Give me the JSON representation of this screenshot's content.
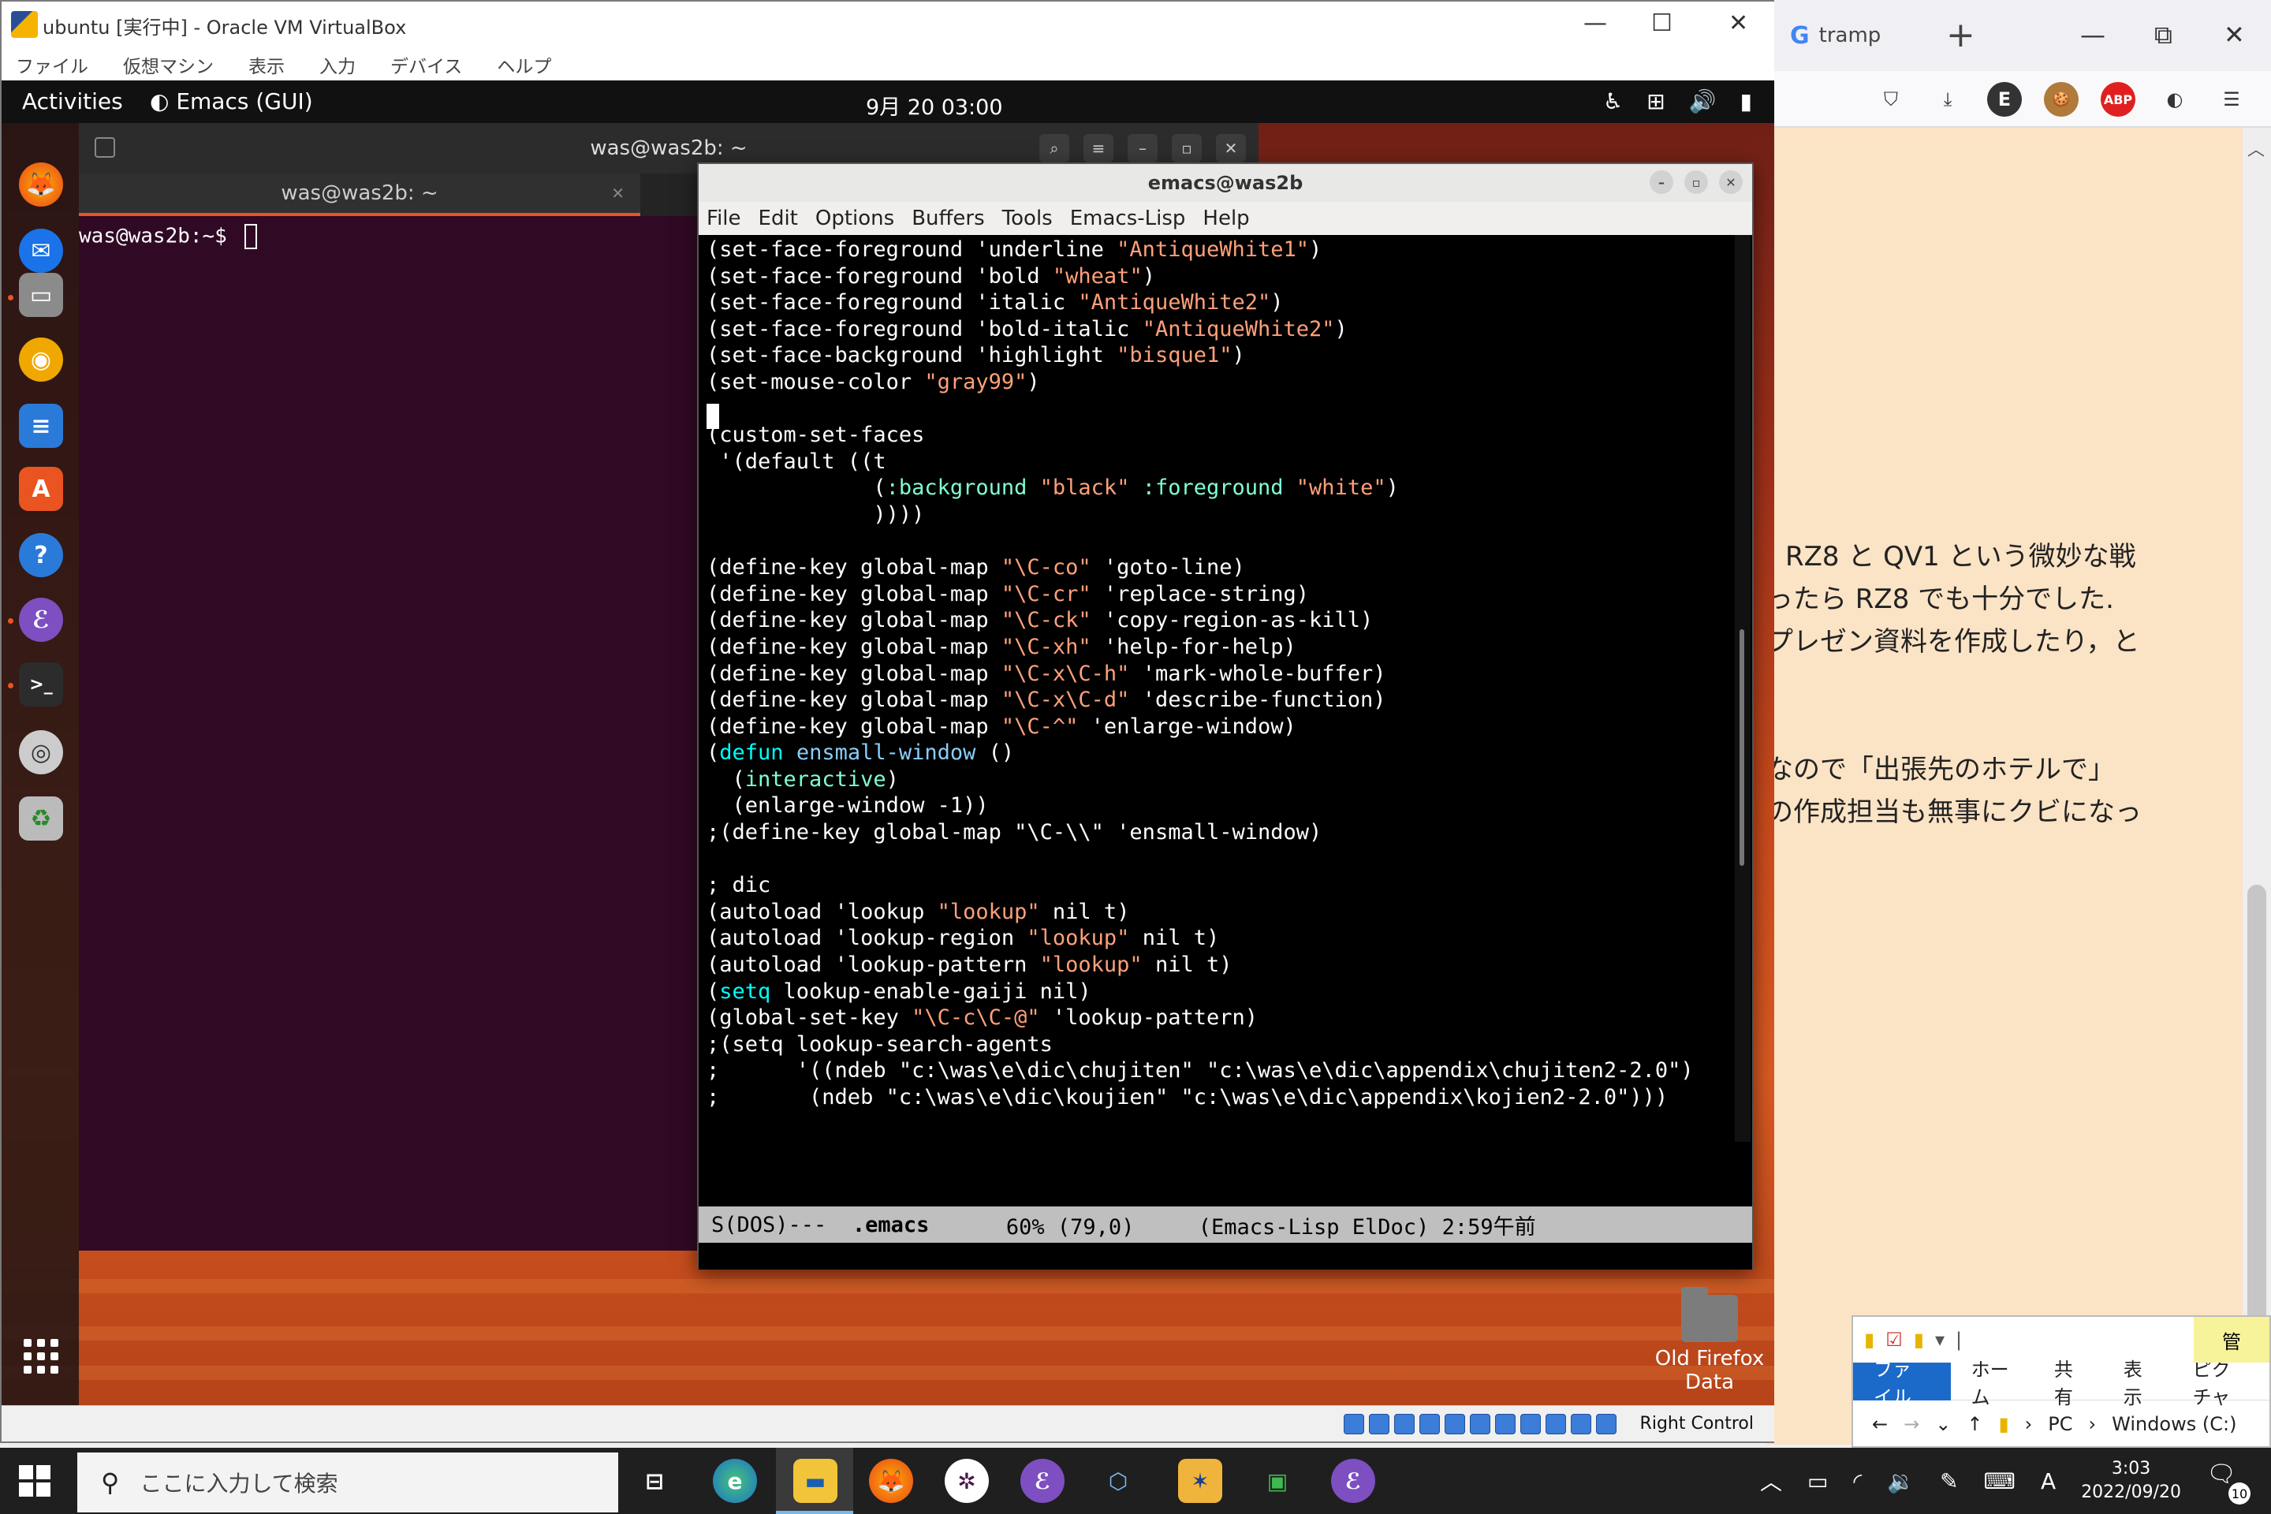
{
  "firefox": {
    "tab_title": "tramp",
    "tab_favicon": "G",
    "new_tab": "+",
    "win_min": "—",
    "win_restore": "⧉",
    "win_close": "✕",
    "toolbar_icons": [
      "pocket-icon",
      "download-icon",
      "extension-e-icon",
      "cookie-icon",
      "adblock-icon",
      "firefox-account-icon",
      "menu-icon"
    ],
    "toolbar_labels": [
      "⛉",
      "⤓",
      "E",
      "🍪",
      "ABP",
      "◐",
      "☰"
    ],
    "content_lines": [
      "RZ8 と QV1 という微妙な戦",
      "ったら RZ8 でも十分でした.",
      "プレゼン資料を作成したり，と",
      "なので「出張先のホテルで」",
      "の作成担当も無事にクビになっ"
    ]
  },
  "explorer": {
    "kanri": "管",
    "ribbon": [
      "ファイル",
      "ホーム",
      "共有",
      "表示",
      "ピクチャ"
    ],
    "address": [
      "PC",
      "Windows (C:)"
    ]
  },
  "vbox": {
    "title": "ubuntu [実行中] - Oracle VM VirtualBox",
    "menu": [
      "ファイル",
      "仮想マシン",
      "表示",
      "入力",
      "デバイス",
      "ヘルプ"
    ],
    "status_right": "Right Control"
  },
  "gnome": {
    "activities": "Activities",
    "app_name": "Emacs (GUI)",
    "clock": "9月 20  03:00"
  },
  "terminal": {
    "header_title": "was@was2b: ~",
    "tab_title": "was@was2b: ~",
    "prompt": "was@was2b:~$ "
  },
  "emacs": {
    "title": "emacs@was2b",
    "menu": [
      "File",
      "Edit",
      "Options",
      "Buffers",
      "Tools",
      "Emacs-Lisp",
      "Help"
    ],
    "modeline": {
      "encoding": "S(DOS)---  ",
      "buffer": ".emacs",
      "position": "      60% (79,0)     (Emacs-Lisp ElDoc) 2:59午前"
    },
    "lines": [
      [
        [
          "c",
          "(set-face-foreground 'underline "
        ],
        [
          "s",
          "\"AntiqueWhite1\""
        ],
        [
          "c",
          ")"
        ]
      ],
      [
        [
          "c",
          "(set-face-foreground 'bold "
        ],
        [
          "s",
          "\"wheat\""
        ],
        [
          "c",
          ")"
        ]
      ],
      [
        [
          "c",
          "(set-face-foreground 'italic "
        ],
        [
          "s",
          "\"AntiqueWhite2\""
        ],
        [
          "c",
          ")"
        ]
      ],
      [
        [
          "c",
          "(set-face-foreground 'bold-italic "
        ],
        [
          "s",
          "\"AntiqueWhite2\""
        ],
        [
          "c",
          ")"
        ]
      ],
      [
        [
          "c",
          "(set-face-background 'highlight "
        ],
        [
          "s",
          "\"bisque1\""
        ],
        [
          "c",
          ")"
        ]
      ],
      [
        [
          "c",
          "(set-mouse-color "
        ],
        [
          "s",
          "\"gray99\""
        ],
        [
          "c",
          ")"
        ]
      ],
      [
        [
          "c",
          ""
        ]
      ],
      [
        [
          "c",
          "(custom-set-faces"
        ]
      ],
      [
        [
          "c",
          " '(default ((t"
        ]
      ],
      [
        [
          "c",
          "             ("
        ],
        [
          "b",
          ":background"
        ],
        [
          "c",
          " "
        ],
        [
          "s",
          "\"black\""
        ],
        [
          "c",
          " "
        ],
        [
          "b",
          ":foreground"
        ],
        [
          "c",
          " "
        ],
        [
          "s",
          "\"white\""
        ],
        [
          "c",
          ")"
        ]
      ],
      [
        [
          "c",
          "             ))))"
        ]
      ],
      [
        [
          "c",
          ""
        ]
      ],
      [
        [
          "c",
          "(define-key global-map "
        ],
        [
          "s",
          "\"\\C-co\""
        ],
        [
          "c",
          " 'goto-line)"
        ]
      ],
      [
        [
          "c",
          "(define-key global-map "
        ],
        [
          "s",
          "\"\\C-cr\""
        ],
        [
          "c",
          " 'replace-string)"
        ]
      ],
      [
        [
          "c",
          "(define-key global-map "
        ],
        [
          "s",
          "\"\\C-ck\""
        ],
        [
          "c",
          " 'copy-region-as-kill)"
        ]
      ],
      [
        [
          "c",
          "(define-key global-map "
        ],
        [
          "s",
          "\"\\C-xh\""
        ],
        [
          "c",
          " 'help-for-help)"
        ]
      ],
      [
        [
          "c",
          "(define-key global-map "
        ],
        [
          "s",
          "\"\\C-x\\C-h\""
        ],
        [
          "c",
          " 'mark-whole-buffer)"
        ]
      ],
      [
        [
          "c",
          "(define-key global-map "
        ],
        [
          "s",
          "\"\\C-x\\C-d\""
        ],
        [
          "c",
          " 'describe-function)"
        ]
      ],
      [
        [
          "c",
          "(define-key global-map "
        ],
        [
          "s",
          "\"\\C-^\""
        ],
        [
          "c",
          " 'enlarge-window)"
        ]
      ],
      [
        [
          "c",
          "("
        ],
        [
          "k",
          "defun"
        ],
        [
          "c",
          " "
        ],
        [
          "f",
          "ensmall-window"
        ],
        [
          "c",
          " ()"
        ]
      ],
      [
        [
          "c",
          "  ("
        ],
        [
          "b",
          "interactive"
        ],
        [
          "c",
          ")"
        ]
      ],
      [
        [
          "c",
          "  (enlarge-window -1))"
        ]
      ],
      [
        [
          "c",
          ";(define-key global-map \"\\C-\\\\\" 'ensmall-window)"
        ]
      ],
      [
        [
          "c",
          ""
        ]
      ],
      [
        [
          "c",
          "; dic"
        ]
      ],
      [
        [
          "c",
          "(autoload 'lookup "
        ],
        [
          "s",
          "\"lookup\""
        ],
        [
          "c",
          " nil t)"
        ]
      ],
      [
        [
          "c",
          "(autoload 'lookup-region "
        ],
        [
          "s",
          "\"lookup\""
        ],
        [
          "c",
          " nil t)"
        ]
      ],
      [
        [
          "c",
          "(autoload 'lookup-pattern "
        ],
        [
          "s",
          "\"lookup\""
        ],
        [
          "c",
          " nil t)"
        ]
      ],
      [
        [
          "c",
          "("
        ],
        [
          "k",
          "setq"
        ],
        [
          "c",
          " lookup-enable-gaiji nil)"
        ]
      ],
      [
        [
          "c",
          "(global-set-key "
        ],
        [
          "s",
          "\"\\C-c\\C-@\""
        ],
        [
          "c",
          " 'lookup-pattern)"
        ]
      ],
      [
        [
          "c",
          ";(setq lookup-search-agents"
        ]
      ],
      [
        [
          "c",
          ";      '((ndeb \"c:\\was\\e\\dic\\chujiten\" \"c:\\was\\e\\dic\\appendix\\chujiten2-2.0\")"
        ]
      ],
      [
        [
          "c",
          ";       (ndeb \"c:\\was\\e\\dic\\koujien\" \"c:\\was\\e\\dic\\appendix\\kojien2-2.0\")))"
        ]
      ]
    ]
  },
  "desktop": {
    "folder_label": "Old Firefox Data"
  },
  "taskbar": {
    "search_placeholder": "ここに入力して検索",
    "time": "3:03",
    "date": "2022/09/20",
    "ime": "A",
    "notifications": "10"
  }
}
